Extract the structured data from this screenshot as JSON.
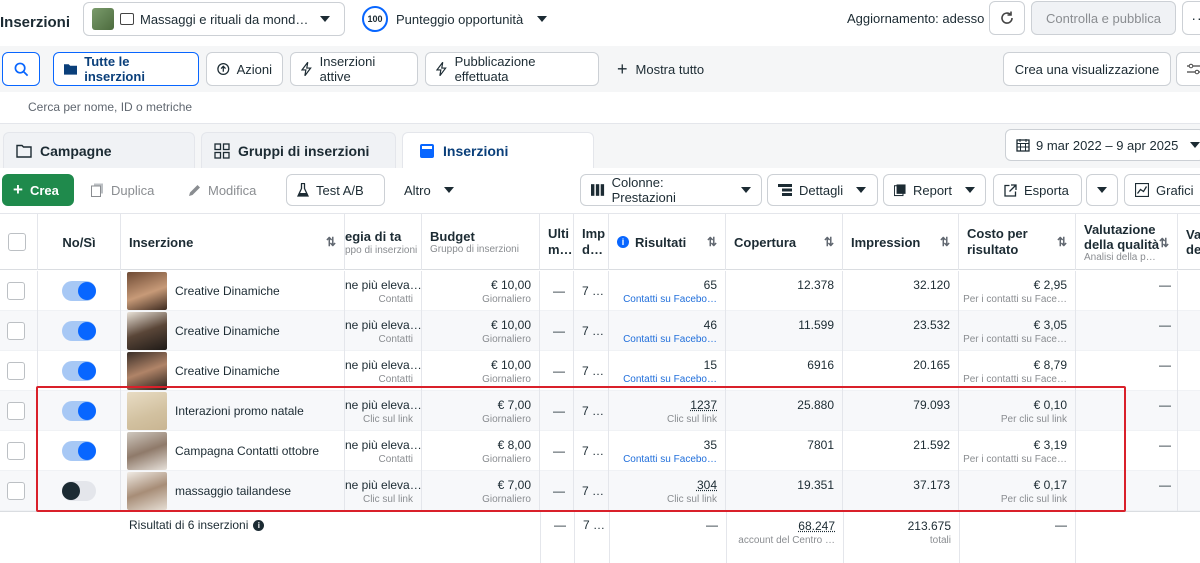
{
  "header": {
    "title": "Inserzioni",
    "account_name": "Massaggi e rituali da mond…",
    "score_value": "100",
    "score_label": "Punteggio opportunità",
    "update_status": "Aggiornamento: adesso",
    "publish_label": "Controlla e pubblica"
  },
  "filters": {
    "all_ads": "Tutte le inserzioni",
    "actions": "Azioni",
    "active_ads": "Inserzioni attive",
    "published": "Pubblicazione effettuata",
    "show_all": "Mostra tutto",
    "create_view": "Crea una visualizzazione"
  },
  "search": {
    "placeholder": "Cerca per nome, ID o metriche"
  },
  "tabs": {
    "campaigns": "Campagne",
    "adsets": "Gruppi di inserzioni",
    "ads": "Inserzioni",
    "date_range": "9 mar 2022 – 9 apr 2025"
  },
  "toolbar": {
    "create": "Crea",
    "duplicate": "Duplica",
    "edit": "Modifica",
    "abtest": "Test A/B",
    "more": "Altro",
    "columns": "Colonne: Prestazioni",
    "breakdown": "Dettagli",
    "report": "Report",
    "export": "Esporta",
    "charts": "Grafici"
  },
  "table": {
    "headers": {
      "onoff": "No/Sì",
      "ad": "Inserzione",
      "strategy": "egia di ta",
      "strategy_sub": "ppo di inserzioni",
      "budget": "Budget",
      "budget_sub": "Gruppo di inserzioni",
      "last": "Ulti m…",
      "imp": "Imp d…",
      "results": "Risultati",
      "reach": "Copertura",
      "impressions": "Impression",
      "cpr": "Costo per risultato",
      "quality": "Valutazione della qualità",
      "quality_sub": "Analisi della p…",
      "next": "Va de"
    },
    "rows": [
      {
        "name": "Creative Dinamiche",
        "on": true,
        "strategy": "ne più eleva…",
        "strategy_sub": "Contatti",
        "budget": "€ 10,00",
        "budget_sub": "Giornaliero",
        "last": "—",
        "imp": "7 …",
        "results": "65",
        "results_sub": "Contatti su Facebo…",
        "results_link": true,
        "reach": "12.378",
        "impressions": "32.120",
        "cpr": "€ 2,95",
        "cpr_sub": "Per i contatti su Face…",
        "quality": "—"
      },
      {
        "name": "Creative Dinamiche",
        "on": true,
        "strategy": "ne più eleva…",
        "strategy_sub": "Contatti",
        "budget": "€ 10,00",
        "budget_sub": "Giornaliero",
        "last": "—",
        "imp": "7 …",
        "results": "46",
        "results_sub": "Contatti su Facebo…",
        "results_link": true,
        "reach": "11.599",
        "impressions": "23.532",
        "cpr": "€ 3,05",
        "cpr_sub": "Per i contatti su Face…",
        "quality": "—"
      },
      {
        "name": "Creative Dinamiche",
        "on": true,
        "strategy": "ne più eleva…",
        "strategy_sub": "Contatti",
        "budget": "€ 10,00",
        "budget_sub": "Giornaliero",
        "last": "—",
        "imp": "7 …",
        "results": "15",
        "results_sub": "Contatti su Facebo…",
        "results_link": true,
        "reach": "6916",
        "impressions": "20.165",
        "cpr": "€ 8,79",
        "cpr_sub": "Per i contatti su Face…",
        "quality": "—"
      },
      {
        "name": "Interazioni promo natale",
        "on": true,
        "strategy": "ne più eleva…",
        "strategy_sub": "Clic sul link",
        "budget": "€ 7,00",
        "budget_sub": "Giornaliero",
        "last": "—",
        "imp": "7 …",
        "results": "1237",
        "results_sub": "Clic sul link",
        "results_link": false,
        "reach": "25.880",
        "impressions": "79.093",
        "cpr": "€ 0,10",
        "cpr_sub": "Per clic sul link",
        "quality": "—"
      },
      {
        "name": "Campagna Contatti ottobre",
        "on": true,
        "strategy": "ne più eleva…",
        "strategy_sub": "Contatti",
        "budget": "€ 8,00",
        "budget_sub": "Giornaliero",
        "last": "—",
        "imp": "7 …",
        "results": "35",
        "results_sub": "Contatti su Facebo…",
        "results_link": true,
        "reach": "7801",
        "impressions": "21.592",
        "cpr": "€ 3,19",
        "cpr_sub": "Per i contatti su Face…",
        "quality": "—"
      },
      {
        "name": "massaggio tailandese",
        "on": false,
        "strategy": "ne più eleva…",
        "strategy_sub": "Clic sul link",
        "budget": "€ 7,00",
        "budget_sub": "Giornaliero",
        "last": "—",
        "imp": "7 …",
        "results": "304",
        "results_sub": "Clic sul link",
        "results_link": false,
        "reach": "19.351",
        "impressions": "37.173",
        "cpr": "€ 0,17",
        "cpr_sub": "Per clic sul link",
        "quality": "—"
      }
    ],
    "totals": {
      "label": "Risultati di 6 inserzioni",
      "last": "—",
      "imp": "7 …",
      "results": "—",
      "reach": "68.247",
      "reach_sub": "account del Centro …",
      "impressions": "213.675",
      "impressions_sub": "totali",
      "cpr": "—"
    }
  },
  "colors": {
    "accent": "#0866ff",
    "create_green": "#1f8a4c",
    "highlight_red": "#d9202a"
  }
}
